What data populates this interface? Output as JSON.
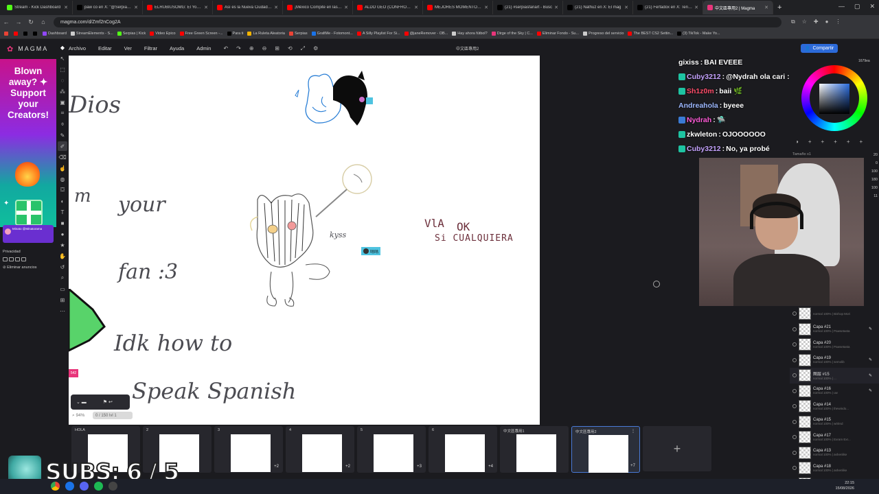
{
  "browser": {
    "tabs": [
      {
        "label": "Stream - Kick Dashboard",
        "icon": "kick",
        "color": "#53fc18"
      },
      {
        "label": "paw co en X: \"@Serpias h",
        "icon": "x",
        "color": "#000000"
      },
      {
        "label": "ELRUBIUSOMG: El YouTub",
        "icon": "youtube",
        "color": "#ff0000"
      },
      {
        "label": "Así es la Nueva Ciudad Pi",
        "icon": "youtube",
        "color": "#ff0000"
      },
      {
        "label": "¡México Compite en las Et",
        "icon": "youtube",
        "color": "#ff0000"
      },
      {
        "label": "ALDO GEO (CONFRONTA",
        "icon": "youtube",
        "color": "#ff0000"
      },
      {
        "label": "MEJORES MOMENTOS EL",
        "icon": "youtube",
        "color": "#ff0000"
      },
      {
        "label": "(21) #serpiasfanart - Busc",
        "icon": "x",
        "color": "#000000"
      },
      {
        "label": "(21) Nathuz en X: El mag",
        "icon": "x",
        "color": "#000000"
      },
      {
        "label": "(21) Ferfadox en X: Tened",
        "icon": "x",
        "color": "#000000"
      },
      {
        "label": "中文區專用2 | Magma",
        "icon": "magma",
        "color": "#e8357a",
        "active": true
      }
    ],
    "url": "magma.com/d/Zmf2nCog2A",
    "bookmarks": [
      {
        "label": "",
        "color": "#ea4335"
      },
      {
        "label": "",
        "color": "#ff0000"
      },
      {
        "label": "",
        "color": "#000000"
      },
      {
        "label": "",
        "color": "#000000"
      },
      {
        "label": "Dashboard",
        "color": "#9147ff"
      },
      {
        "label": "StreamElements - S...",
        "color": "#cccccc"
      },
      {
        "label": "Serpias | Kick",
        "color": "#53fc18"
      },
      {
        "label": "Video Epico",
        "color": "#ff0000"
      },
      {
        "label": "Free Green Screen -...",
        "color": "#ff0000"
      },
      {
        "label": "Para ti",
        "color": "#000000"
      },
      {
        "label": "La Ruleta Aleatoria",
        "color": "#f4b400"
      },
      {
        "label": "Serpias",
        "color": "#ea4335"
      },
      {
        "label": "GrafiMe - Fotomont...",
        "color": "#1a73e8"
      },
      {
        "label": "A Silly Playlist For Si...",
        "color": "#ff0000"
      },
      {
        "label": "@janeRemover - OB...",
        "color": "#ff0000"
      },
      {
        "label": "Hay ahora fútbol?",
        "color": "#cccccc"
      },
      {
        "label": "Dirge of the Sky | C...",
        "color": "#e8357a"
      },
      {
        "label": "Eliminar Fondo - Su...",
        "color": "#ff0000"
      },
      {
        "label": "Progreso del servicio",
        "color": "#cccccc"
      },
      {
        "label": "The BEST CS2 Settin...",
        "color": "#ff0000"
      },
      {
        "label": "(3) TikTok - Make Yo...",
        "color": "#000000"
      }
    ]
  },
  "app": {
    "brand": "MAGMA",
    "menu": [
      "Archivo",
      "Editar",
      "Ver",
      "Filtrar",
      "Ayuda",
      "Admin"
    ],
    "doc_title": "中文區專用2",
    "share_label": "Compartir",
    "zoom_readout": "1679ea"
  },
  "ad": {
    "headline": "Blown away? ✦ Support your Creators!",
    "user": "Minato @Minatorama",
    "privacy_label": "Privacidad",
    "remove_label": "Eliminar anuncios"
  },
  "canvas": {
    "texts": {
      "dios": "Dios",
      "m": "m",
      "your": "your",
      "fan": "fan  :3",
      "idk": "Idk how to",
      "speak": "Speak Spanish",
      "ok": "OK",
      "vla": "VlA",
      "cualquiera": "Si  CUALQUIERA",
      "kyss": "kyss",
      "tag1": "咕咕",
      "tag2": "542"
    },
    "zoom_percent": "94%",
    "zoom_bar": "0 / 150 lvl 1"
  },
  "chat": [
    {
      "user": "gixiss",
      "message": "BAI EVEEE",
      "color": "#ffffff"
    },
    {
      "user": "Cuby3212",
      "message": "@Nydrah ola cari :3c",
      "color": "#c5a3ff",
      "mention_color": "#9db8ff"
    },
    {
      "user": "Sh1z0m",
      "message": "baii 🌿",
      "color": "#ff4d6a"
    },
    {
      "user": "Andreahola",
      "message": "byeee",
      "color": "#9db8ff"
    },
    {
      "user": "Nydrah",
      "message": "🛸",
      "color": "#ff5bd8"
    },
    {
      "user": "zkwleton",
      "message": "OJOOOOOO",
      "color": "#ffffff"
    },
    {
      "user": "Cuby3212",
      "message": "No, ya probé",
      "color": "#c5a3ff"
    }
  ],
  "right_panel": {
    "size_label": "Tamaño x1",
    "slider_values": [
      "20",
      "0",
      "100",
      "180",
      "100",
      "11"
    ]
  },
  "layers": [
    {
      "name": "",
      "meta": "normal 100% | Bishop Mori"
    },
    {
      "name": "Capa #21",
      "meta": "normal 100% | Pawsetasta",
      "pen": true
    },
    {
      "name": "Capa #20",
      "meta": "normal 100% | Pawsetasta"
    },
    {
      "name": "Capa #19",
      "meta": "normal 100% | semolib",
      "pen": true
    },
    {
      "name": "图层 #15",
      "meta": "normal 100% | ...",
      "pen": true,
      "selected": true
    },
    {
      "name": "Capa #16",
      "meta": "normal 100% | uw",
      "pen": true
    },
    {
      "name": "Capa #14",
      "meta": "normal 100% | thewindo..."
    },
    {
      "name": "Capa #15",
      "meta": "normal 100% | w00nd"
    },
    {
      "name": "Capa #17",
      "meta": "normal 100% | Exram Exr..."
    },
    {
      "name": "Capa #13",
      "meta": "normal 100% | ashenlike"
    },
    {
      "name": "Capa #18",
      "meta": "normal 100% | ashenlike"
    },
    {
      "name": "图层 #5",
      "meta": "",
      "pen": true
    }
  ],
  "boards": [
    {
      "label": "HOLA",
      "count": ""
    },
    {
      "label": "2",
      "count": ""
    },
    {
      "label": "3",
      "count": "+2"
    },
    {
      "label": "4",
      "count": "+2"
    },
    {
      "label": "5",
      "count": "+3"
    },
    {
      "label": "6",
      "count": "+4"
    },
    {
      "label": "中文區專用1",
      "count": ""
    },
    {
      "label": "中文區專用2",
      "count": "+7",
      "active": true
    }
  ],
  "overlay": {
    "subs": "SUBS: 6 / 5"
  },
  "taskbar": {
    "time": "22:15",
    "date": "15/08/2026"
  }
}
